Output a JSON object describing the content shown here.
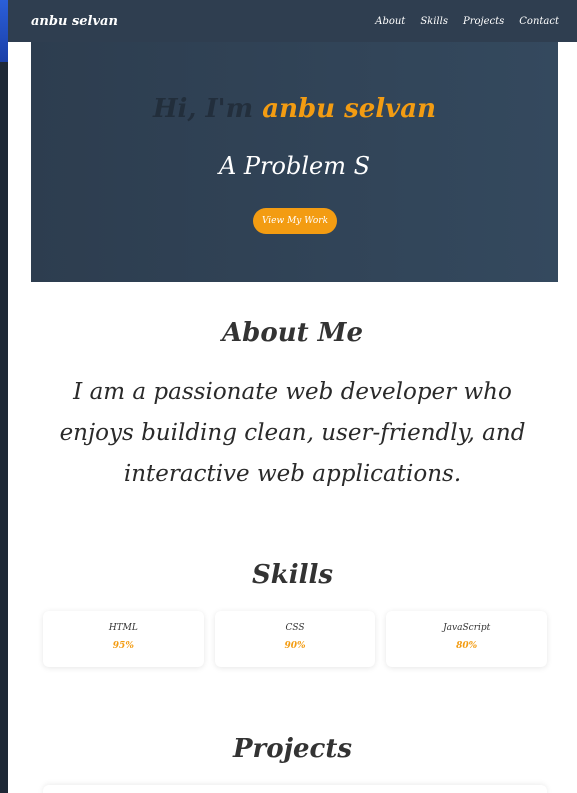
{
  "nav": {
    "brand": "anbu selvan",
    "links": [
      {
        "label": "About"
      },
      {
        "label": "Skills"
      },
      {
        "label": "Projects"
      },
      {
        "label": "Contact"
      }
    ]
  },
  "hero": {
    "greeting": "Hi, I'm",
    "name": "anbu selvan",
    "role_typed": "A Problem S",
    "button_label": "View My Work"
  },
  "about": {
    "heading": "About Me",
    "text": "I am a passionate web developer who enjoys building clean, user-friendly, and interactive web applications."
  },
  "skills": {
    "heading": "Skills",
    "items": [
      {
        "name": "HTML",
        "percent": "95%"
      },
      {
        "name": "CSS",
        "percent": "90%"
      },
      {
        "name": "JavaScript",
        "percent": "80%"
      }
    ]
  },
  "projects": {
    "heading": "Projects"
  },
  "colors": {
    "accent": "#f39c12",
    "nav_bg": "#2f3e50",
    "hero_bg": "#34495e",
    "text_dark": "#333333"
  }
}
